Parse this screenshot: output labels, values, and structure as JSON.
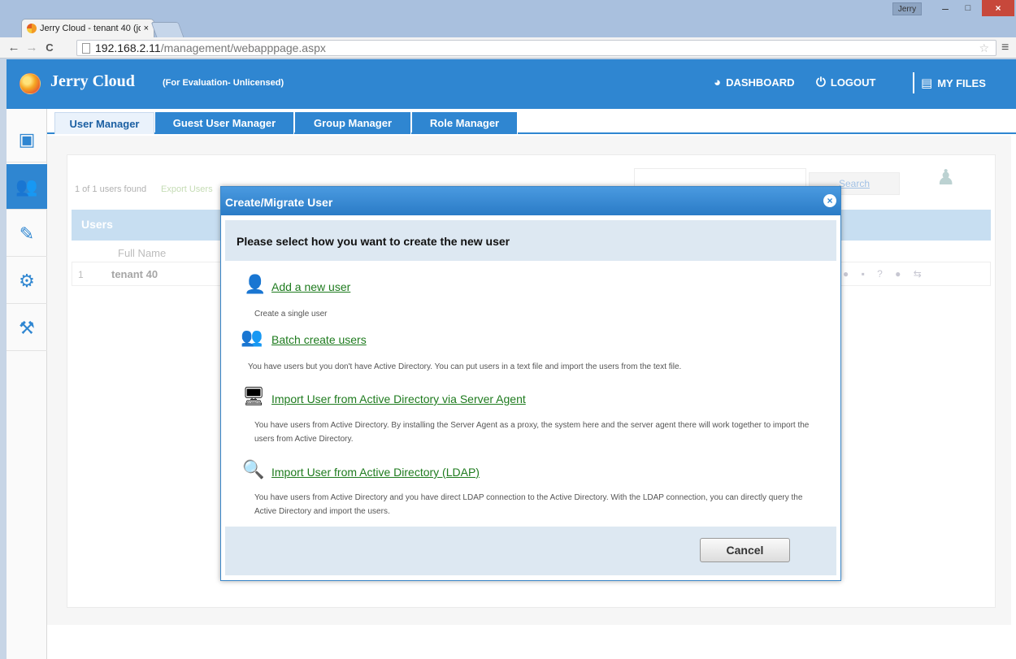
{
  "browser": {
    "tab_title": "Jerry Cloud - tenant 40 (jo",
    "tab_close": "×",
    "profile": "Jerry",
    "win_min": "–",
    "win_max": "□",
    "win_close": "×",
    "back": "←",
    "forward": "→",
    "reload": "C",
    "url_host": "192.168.2.11",
    "url_path": "/management/webapppage.aspx",
    "star": "☆",
    "menu": "≡"
  },
  "header": {
    "title": "Jerry Cloud",
    "subtitle": "(For Evaluation- Unlicensed)",
    "dashboard": "DASHBOARD",
    "logout": "LOGOUT",
    "my_files": "MY FILES"
  },
  "tabs": [
    {
      "label": "User Manager"
    },
    {
      "label": "Guest User Manager"
    },
    {
      "label": "Group Manager"
    },
    {
      "label": "Role Manager"
    }
  ],
  "list": {
    "found": "1 of 1 users found",
    "export": "Export Users",
    "search_label": "Search",
    "users_title": "Users",
    "col_fullname": "Full Name",
    "row_num": "1",
    "row_name": "tenant 40"
  },
  "modal": {
    "title": "Create/Migrate User",
    "close": "×",
    "prompt": "Please select how you want to create the new user",
    "options": [
      {
        "label": "Add a new user",
        "desc": "Create a single user"
      },
      {
        "label": "Batch create users",
        "desc": "You have users but you don't have Active Directory. You can put users in a text file and import the users from the text file."
      },
      {
        "label": "Import User from Active Directory via Server Agent",
        "desc": "You have users from Active Directory. By installing the Server Agent as a proxy, the system here and the server agent there will work together to import the users from Active Directory."
      },
      {
        "label": "Import User from Active Directory (LDAP)",
        "desc": "You have users from Active Directory and you have direct LDAP connection to the Active Directory. With the LDAP connection, you can directly query the Active Directory and import the users."
      }
    ],
    "cancel": "Cancel"
  },
  "colors": {
    "brand_blue": "#2f86d1",
    "link_green": "#1e7b1e",
    "close_red": "#c7483b"
  }
}
